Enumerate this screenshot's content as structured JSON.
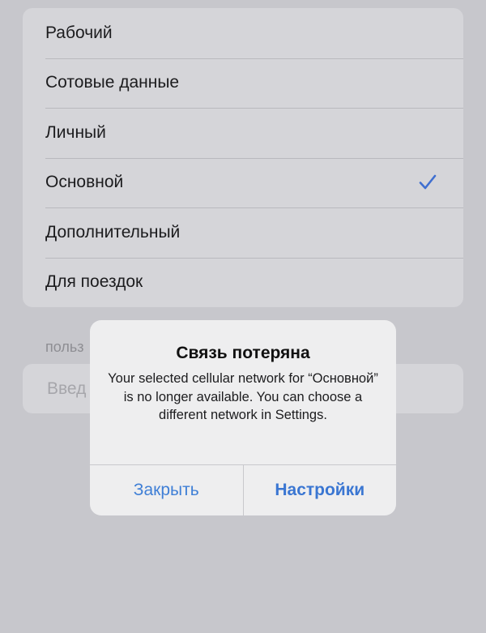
{
  "plans": [
    {
      "label": "Рабочий",
      "selected": false
    },
    {
      "label": "Сотовые данные",
      "selected": false
    },
    {
      "label": "Личный",
      "selected": false
    },
    {
      "label": "Основной",
      "selected": true
    },
    {
      "label": "Дополнительный",
      "selected": false
    },
    {
      "label": "Для поездок",
      "selected": false
    }
  ],
  "custom_label": {
    "header": "польз",
    "placeholder": "Введ"
  },
  "alert": {
    "title": "Связь потеряна",
    "message": "Your selected cellular network for “Основной” is no longer available. You can choose a different network in Settings.",
    "close_label": "Закрыть",
    "settings_label": "Настройки"
  },
  "colors": {
    "accent": "#3f7fd6",
    "checkmark": "#3f6fd0"
  },
  "icons": {
    "selected": "checkmark-icon"
  }
}
